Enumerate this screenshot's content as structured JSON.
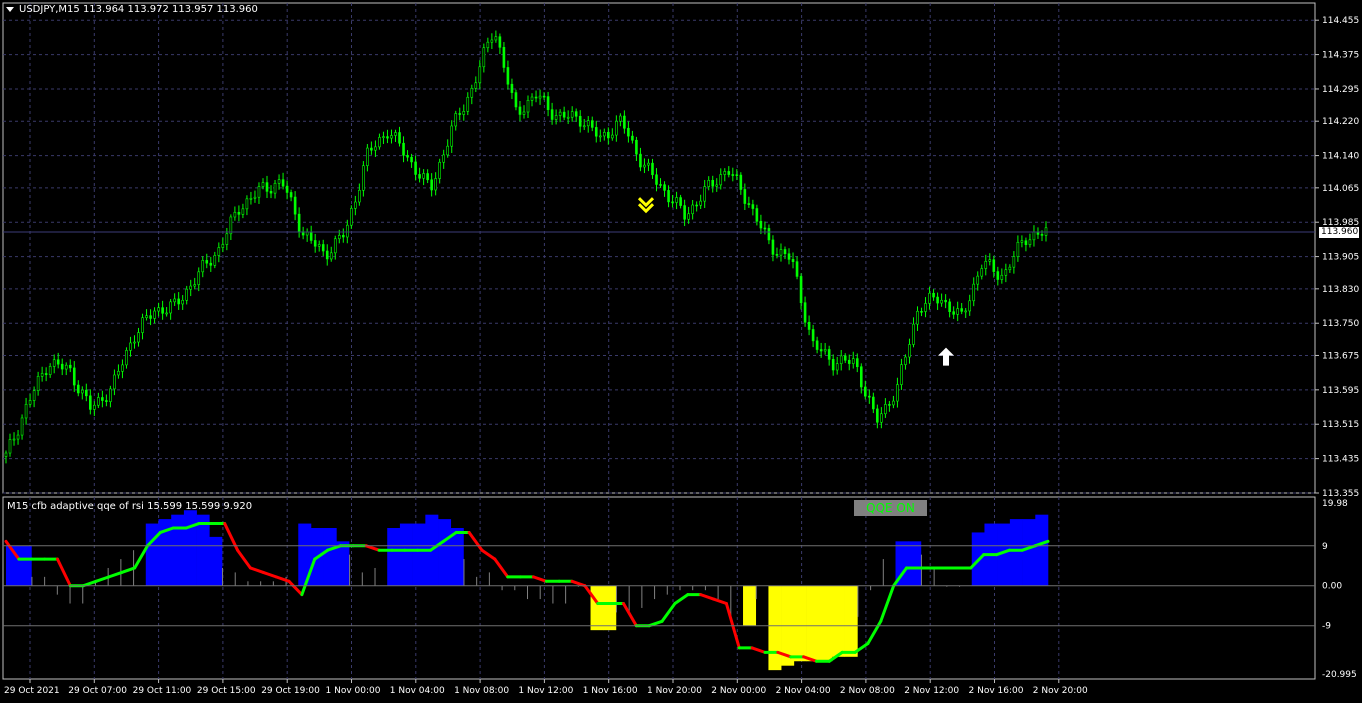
{
  "window": {
    "main_header": "USDJPY,M15  113.964 113.972 113.957 113.960",
    "sub_header": "M15  cfb adaptive qqe of rsi 15.599 15.599 9.920",
    "badge_text": "QQE ON",
    "current_price": "113.960"
  },
  "price_axis_labels": [
    "114.455",
    "114.375",
    "114.295",
    "114.220",
    "114.140",
    "114.065",
    "113.985",
    "113.905",
    "113.830",
    "113.750",
    "113.675",
    "113.595",
    "113.515",
    "113.435",
    "113.355"
  ],
  "sub_axis_labels": [
    "19.98",
    "9",
    "0.00",
    "-9",
    "-20.995"
  ],
  "time_axis_labels": [
    "29 Oct 2021",
    "29 Oct 07:00",
    "29 Oct 11:00",
    "29 Oct 15:00",
    "29 Oct 19:00",
    "1 Nov 00:00",
    "1 Nov 04:00",
    "1 Nov 08:00",
    "1 Nov 12:00",
    "1 Nov 16:00",
    "1 Nov 20:00",
    "2 Nov 00:00",
    "2 Nov 04:00",
    "2 Nov 08:00",
    "2 Nov 12:00",
    "2 Nov 16:00",
    "2 Nov 20:00"
  ],
  "colors": {
    "candle": "#00ff00",
    "grid": "#3a3a6a",
    "up_hist": "#0000ff",
    "down_hist": "#ffff00",
    "qqe_up": "#00ff00",
    "qqe_down": "#ff0000",
    "signal_up": "#ffffff",
    "signal_down": "#ffff00"
  },
  "chart_data": [
    {
      "type": "line",
      "title": "USDJPY,M15",
      "symbol": "USDJPY",
      "timeframe": "M15",
      "price_close_path": [
        113.44,
        113.56,
        113.66,
        113.64,
        113.55,
        113.6,
        113.72,
        113.78,
        113.79,
        113.86,
        113.92,
        114.02,
        114.06,
        114.08,
        113.96,
        113.91,
        113.96,
        114.14,
        114.2,
        114.13,
        114.06,
        114.2,
        114.3,
        114.44,
        114.24,
        114.28,
        114.23,
        114.23,
        114.18,
        114.22,
        114.12,
        114.06,
        114.0,
        114.06,
        114.11,
        114.03,
        113.93,
        113.9,
        113.7,
        113.66,
        113.66,
        113.52,
        113.6,
        113.79,
        113.81,
        113.76,
        113.89,
        113.86,
        113.95,
        113.96
      ],
      "ylim": [
        113.355,
        114.495
      ],
      "current_price": 113.96,
      "signals": [
        {
          "type": "sell",
          "at": "1 Nov 20:00 approx",
          "price": 114.02
        },
        {
          "type": "buy",
          "at": "2 Nov 13:00 approx",
          "price": 113.67
        }
      ]
    },
    {
      "type": "area",
      "title": "cfb adaptive qqe of rsi",
      "ylim": [
        -20.995,
        19.98
      ],
      "levels": [
        9,
        0,
        -9
      ],
      "values_header": [
        15.599,
        15.599,
        9.92
      ],
      "histogram": [
        9,
        9,
        2,
        2,
        -2,
        -4,
        -4,
        1,
        4,
        6,
        8,
        14,
        15,
        16,
        17,
        16,
        11,
        4,
        3,
        1,
        1,
        1,
        2,
        14,
        13,
        13,
        10,
        7,
        3,
        4,
        13,
        14,
        14,
        16,
        15,
        13,
        6,
        2,
        3,
        -1,
        -1,
        -3,
        -3,
        -4,
        -4,
        0,
        -10,
        -10,
        -6,
        -6,
        -5,
        -3,
        -2,
        -1,
        -1,
        -1,
        -3,
        -8,
        -9,
        -3,
        -19,
        -18,
        -17,
        -17,
        -17,
        -16,
        -16,
        -7,
        -1,
        6,
        10,
        10,
        7,
        4,
        0,
        0,
        12,
        14,
        14,
        15,
        15,
        16
      ],
      "qqe_line": [
        10,
        6,
        6,
        6,
        6,
        0,
        0,
        1,
        2,
        3,
        4,
        9,
        12,
        13,
        13,
        14,
        14,
        14,
        8,
        4,
        3,
        2,
        1,
        -2,
        6,
        8,
        9,
        9,
        9,
        8,
        8,
        8,
        8,
        8,
        10,
        12,
        12,
        8,
        6,
        2,
        2,
        2,
        1,
        1,
        1,
        0,
        -4,
        -4,
        -4,
        -9,
        -9,
        -8,
        -4,
        -2,
        -2,
        -3,
        -4,
        -14,
        -14,
        -15,
        -15,
        -16,
        -16,
        -17,
        -17,
        -15,
        -15,
        -13,
        -8,
        0,
        4,
        4,
        4,
        4,
        4,
        4,
        7,
        7,
        8,
        8,
        9,
        10
      ],
      "qqe_trend_note": "green = rising, red = falling"
    }
  ]
}
